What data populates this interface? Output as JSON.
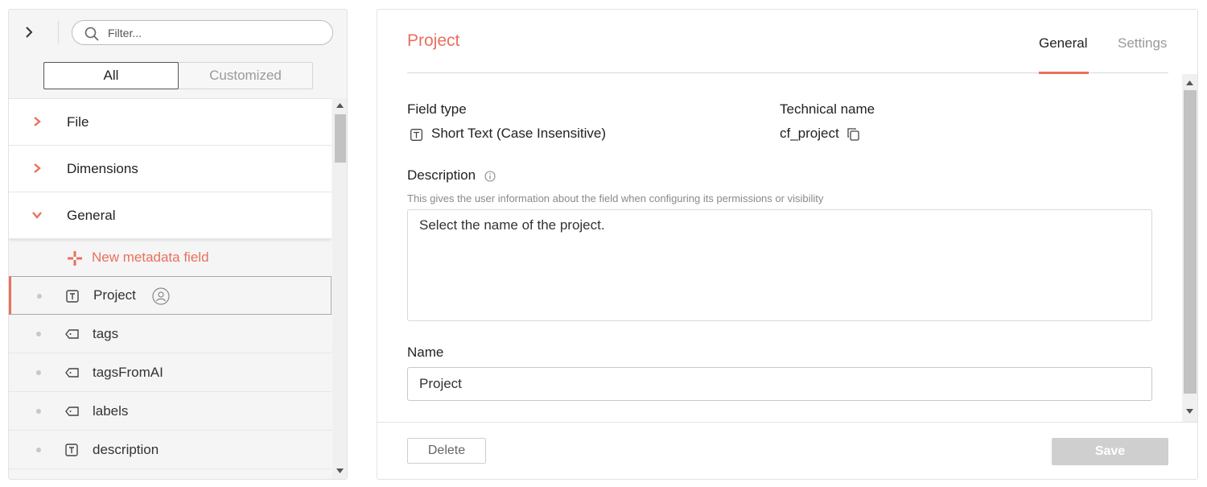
{
  "colors": {
    "accent": "#e8705e",
    "text": "#222222",
    "muted": "#999999",
    "panel_bg": "#f5f5f5",
    "save_disabled": "#cfcfcf"
  },
  "sidebar": {
    "filter_placeholder": "Filter...",
    "toggle": {
      "all": "All",
      "customized": "Customized",
      "selected": "All"
    },
    "groups": [
      {
        "label": "File",
        "expanded": false
      },
      {
        "label": "Dimensions",
        "expanded": false
      },
      {
        "label": "General",
        "expanded": true
      }
    ],
    "new_field_label": "New metadata field",
    "fields": [
      {
        "label": "Project",
        "icon": "text-field-icon",
        "selected": true,
        "badge": "person-icon"
      },
      {
        "label": "tags",
        "icon": "tag-icon"
      },
      {
        "label": "tagsFromAI",
        "icon": "tag-icon"
      },
      {
        "label": "labels",
        "icon": "tag-icon"
      },
      {
        "label": "description",
        "icon": "text-field-icon"
      }
    ]
  },
  "detail": {
    "title": "Project",
    "tabs": {
      "general": "General",
      "settings": "Settings",
      "active": "General"
    },
    "field_type_label": "Field type",
    "field_type_value": "Short Text (Case Insensitive)",
    "technical_name_label": "Technical name",
    "technical_name_value": "cf_project",
    "description_label": "Description",
    "description_hint": "This gives the user information about the field when configuring its permissions or visibility",
    "description_value": "Select the name of the project.",
    "name_label": "Name",
    "name_value": "Project",
    "delete_label": "Delete",
    "save_label": "Save"
  }
}
